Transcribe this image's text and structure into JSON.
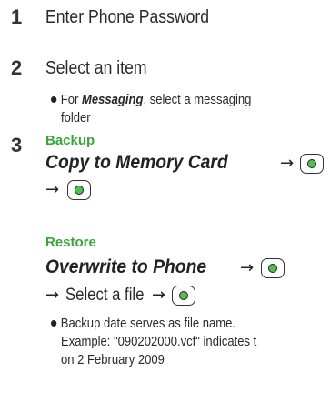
{
  "steps": [
    {
      "number": "1",
      "text": "Enter Phone Password"
    },
    {
      "number": "2",
      "text": "Select an item"
    },
    {
      "number": "3"
    }
  ],
  "step2_bullet": {
    "prefix": "For ",
    "emphasis": "Messaging",
    "suffix": ", select a messaging",
    "line2": "folder"
  },
  "backup": {
    "heading": "Backup",
    "command": "Copy to Memory Card"
  },
  "restore": {
    "heading": "Restore",
    "command": "Overwrite to Phone",
    "select_file": "Select a file"
  },
  "note": {
    "line1": "Backup date serves as file name.",
    "line2": "Example: \"090202000.vcf\" indicates t",
    "line3": "on 2 February 2009"
  },
  "arrow_glyph": "→",
  "icons": {
    "center_key": "center-key-icon"
  },
  "colors": {
    "heading_green": "#3aa53a",
    "key_dot": "#4ec24e"
  }
}
